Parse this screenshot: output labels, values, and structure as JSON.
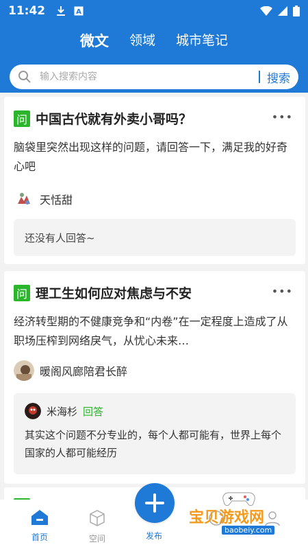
{
  "status_bar": {
    "time": "11:42"
  },
  "header": {
    "tabs": [
      {
        "label": "微文",
        "active": true
      },
      {
        "label": "领域",
        "active": false
      },
      {
        "label": "城市笔记",
        "active": false
      }
    ]
  },
  "search": {
    "placeholder": "输入搜索内容",
    "button_label": "搜索"
  },
  "feed": [
    {
      "badge": "问",
      "title": "中国古代就有外卖小哥吗？",
      "description": "脑袋里突然出现这样的问题，请回答一下，满足我的好奇心吧",
      "author": "天恬甜",
      "answer_placeholder": "还没有人回答~"
    },
    {
      "badge": "问",
      "title": "理工生如何应对焦虑与不安",
      "description": "经济转型期的不健康竞争和“内卷”在一定程度上造成了从职场压榨到网络戾气，从忧心未来…",
      "author": "暖阁风廊陪君长醉",
      "answer": {
        "author": "米海杉",
        "tag": "回答",
        "text": "其实这个问题不分专业的，每个人都可能有，世界上每个国家的人都可能经历"
      }
    }
  ],
  "bottom_nav": {
    "home": "首页",
    "space": "空间",
    "publish": "发布"
  },
  "watermark": {
    "text": "宝贝游戏网",
    "url": "baobeiy.com"
  },
  "colors": {
    "primary": "#1e7ad6",
    "badge_green": "#2bb52b",
    "background": "#f2f2f2"
  }
}
